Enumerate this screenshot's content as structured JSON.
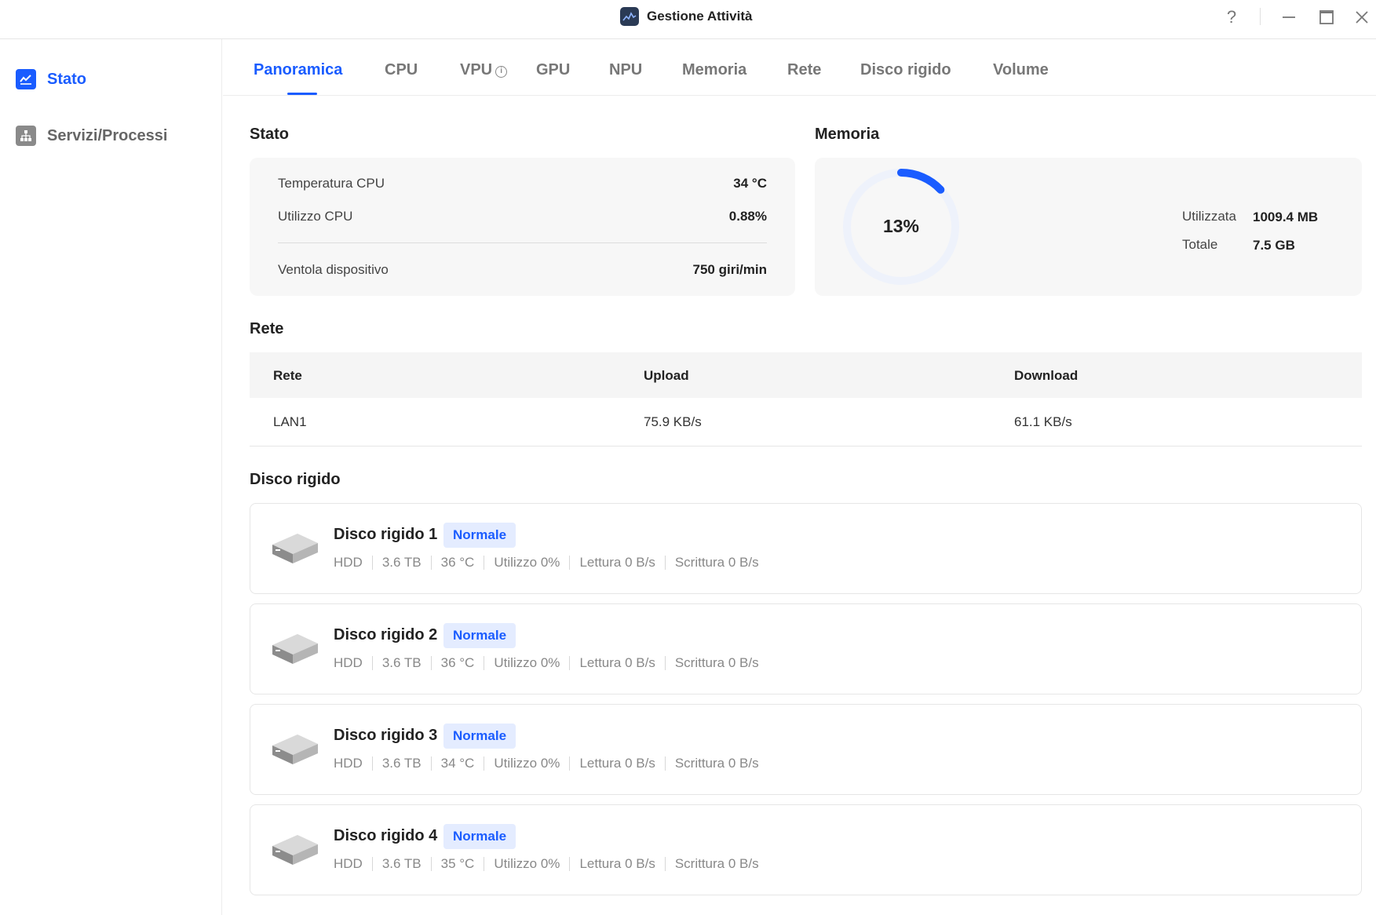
{
  "window": {
    "title": "Gestione Attività",
    "help": "?",
    "minimize": "—",
    "maximize": "☐",
    "close": "✕"
  },
  "sidebar": {
    "items": [
      {
        "label": "Stato",
        "icon": "chart-line-icon",
        "active": true
      },
      {
        "label": "Servizi/Processi",
        "icon": "hierarchy-icon",
        "active": false
      }
    ]
  },
  "tabs": [
    {
      "label": "Panoramica",
      "active": true
    },
    {
      "label": "CPU"
    },
    {
      "label": "VPU"
    },
    {
      "label": "GPU"
    },
    {
      "label": "NPU"
    },
    {
      "label": "Memoria"
    },
    {
      "label": "Rete"
    },
    {
      "label": "Disco rigido"
    },
    {
      "label": "Volume"
    }
  ],
  "status": {
    "title": "Stato",
    "cpu_temp_label": "Temperatura CPU",
    "cpu_temp_value": "34 °C",
    "cpu_usage_label": "Utilizzo CPU",
    "cpu_usage_value": "0.88%",
    "fan_label": "Ventola dispositivo",
    "fan_value": "750 giri/min"
  },
  "memory": {
    "title": "Memoria",
    "percent_label": "13%",
    "percent": 13,
    "used_label": "Utilizzata",
    "used_value": "1009.4 MB",
    "total_label": "Totale",
    "total_value": "7.5 GB"
  },
  "network": {
    "title": "Rete",
    "headers": [
      "Rete",
      "Upload",
      "Download"
    ],
    "rows": [
      {
        "name": "LAN1",
        "upload": "75.9 KB/s",
        "download": "61.1 KB/s"
      }
    ]
  },
  "disks": {
    "title": "Disco rigido",
    "items": [
      {
        "name": "Disco rigido 1",
        "status": "Normale",
        "type": "HDD",
        "size": "3.6 TB",
        "temp": "36 °C",
        "usage": "Utilizzo 0%",
        "read": "Lettura 0 B/s",
        "write": "Scrittura 0 B/s"
      },
      {
        "name": "Disco rigido 2",
        "status": "Normale",
        "type": "HDD",
        "size": "3.6 TB",
        "temp": "36 °C",
        "usage": "Utilizzo 0%",
        "read": "Lettura 0 B/s",
        "write": "Scrittura 0 B/s"
      },
      {
        "name": "Disco rigido 3",
        "status": "Normale",
        "type": "HDD",
        "size": "3.6 TB",
        "temp": "34 °C",
        "usage": "Utilizzo 0%",
        "read": "Lettura 0 B/s",
        "write": "Scrittura 0 B/s"
      },
      {
        "name": "Disco rigido 4",
        "status": "Normale",
        "type": "HDD",
        "size": "3.6 TB",
        "temp": "35 °C",
        "usage": "Utilizzo 0%",
        "read": "Lettura 0 B/s",
        "write": "Scrittura 0 B/s"
      }
    ]
  },
  "colors": {
    "accent": "#1a5cff",
    "ring_track": "#eef2fb",
    "badge_bg": "#e4ecff"
  }
}
